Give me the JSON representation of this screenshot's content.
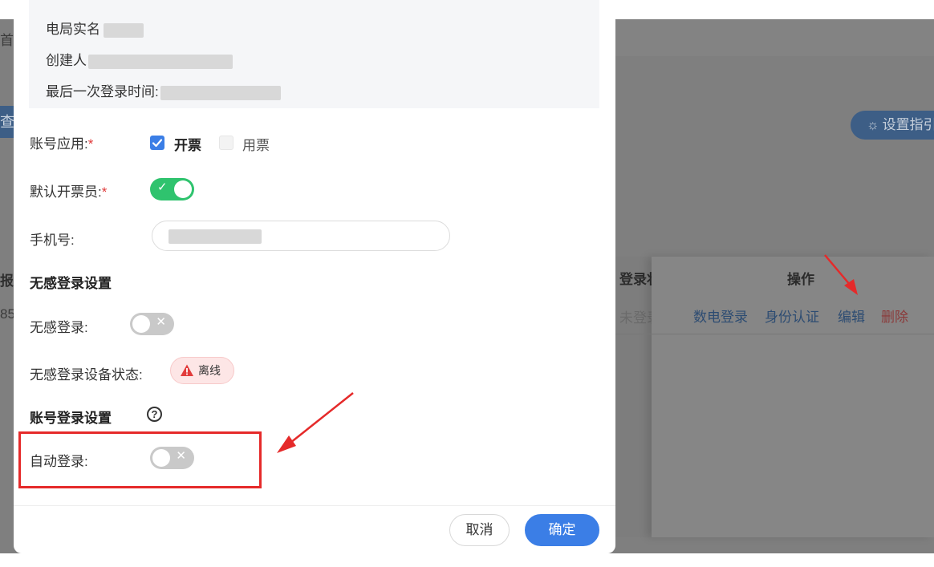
{
  "background": {
    "nav_fragment": "首设",
    "query_fragment": "查",
    "guide_button": "设置指引",
    "table": {
      "col_left_fragment": "报账",
      "col_login_status": "登录状",
      "col_actions": "操作",
      "row_left_fragment": "85",
      "row_login_status": "未登录",
      "actions": [
        "数电登录",
        "身份认证",
        "编辑",
        "删除"
      ]
    }
  },
  "modal": {
    "info": {
      "real_name_label": "电局实名",
      "creator_label": "创建人",
      "last_login_label": "最后一次登录时间:"
    },
    "account_usage": {
      "label": "账号应用:",
      "required_mark": "*",
      "options": [
        {
          "label": "开票",
          "checked": true
        },
        {
          "label": "用票",
          "checked": false
        }
      ]
    },
    "default_issuer": {
      "label": "默认开票员:",
      "required_mark": "*",
      "enabled": true,
      "on_mark": "✓"
    },
    "phone": {
      "label": "手机号:"
    },
    "seamless_section": {
      "title": "无感登录设置",
      "seamless_login_label": "无感登录:",
      "seamless_login_enabled": false,
      "device_status_label": "无感登录设备状态:",
      "device_status": "离线",
      "off_mark": "✕"
    },
    "account_login_section": {
      "title": "账号登录设置",
      "help_mark": "?",
      "auto_login_label": "自动登录:",
      "auto_login_enabled": false
    },
    "footer": {
      "cancel": "取消",
      "confirm": "确定"
    }
  },
  "colors": {
    "primary": "#3b7ee6",
    "switch_on": "#2fc36e",
    "switch_off": "#c9c9c9",
    "offline_bg": "#fde6e6",
    "annotation_red": "#e52a2a"
  }
}
